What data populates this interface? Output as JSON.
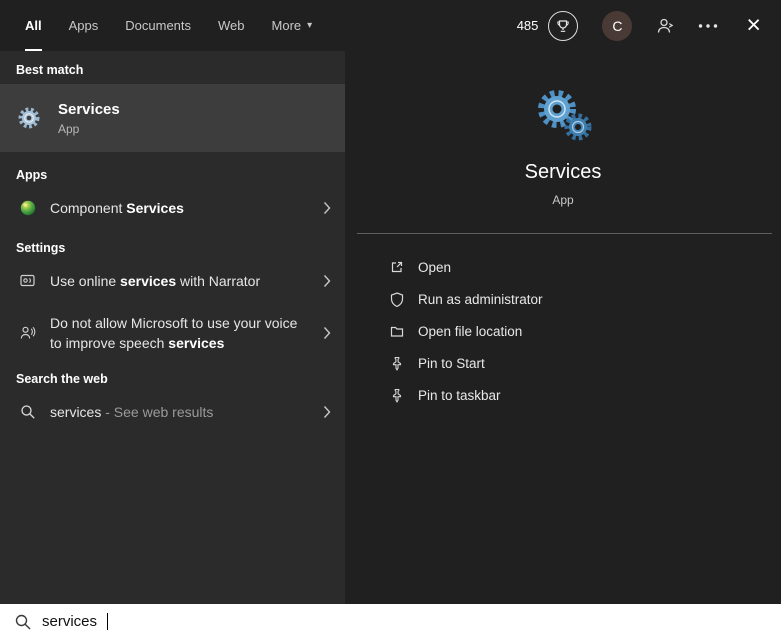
{
  "topbar": {
    "tabs": [
      "All",
      "Apps",
      "Documents",
      "Web",
      "More"
    ],
    "rewards_points": "485",
    "avatar_initial": "C",
    "icons": {
      "more_caret": "▾",
      "close": "×"
    }
  },
  "left_panel": {
    "best_match": {
      "header": "Best match",
      "title": "Services",
      "subtitle": "App"
    },
    "apps": {
      "header": "Apps",
      "item": {
        "pre": "Component ",
        "bold": "Services"
      }
    },
    "settings": {
      "header": "Settings",
      "items": [
        {
          "pre": "Use online ",
          "bold": "services",
          "post": " with Narrator"
        },
        {
          "pre": "Do not allow Microsoft to use your voice to improve speech ",
          "bold": "services"
        }
      ]
    },
    "web": {
      "header": "Search the web",
      "item": {
        "pre": "services ",
        "dim": "- See web results"
      }
    }
  },
  "preview": {
    "title": "Services",
    "subtitle": "App",
    "actions": [
      "Open",
      "Run as administrator",
      "Open file location",
      "Pin to Start",
      "Pin to taskbar"
    ]
  },
  "search": {
    "value": "services"
  },
  "colors": {
    "panel_dark": "#202020",
    "panel_light": "#2b2b2b",
    "selected_row": "#3d3d3d",
    "gear_blue": "#5ea0d0"
  }
}
